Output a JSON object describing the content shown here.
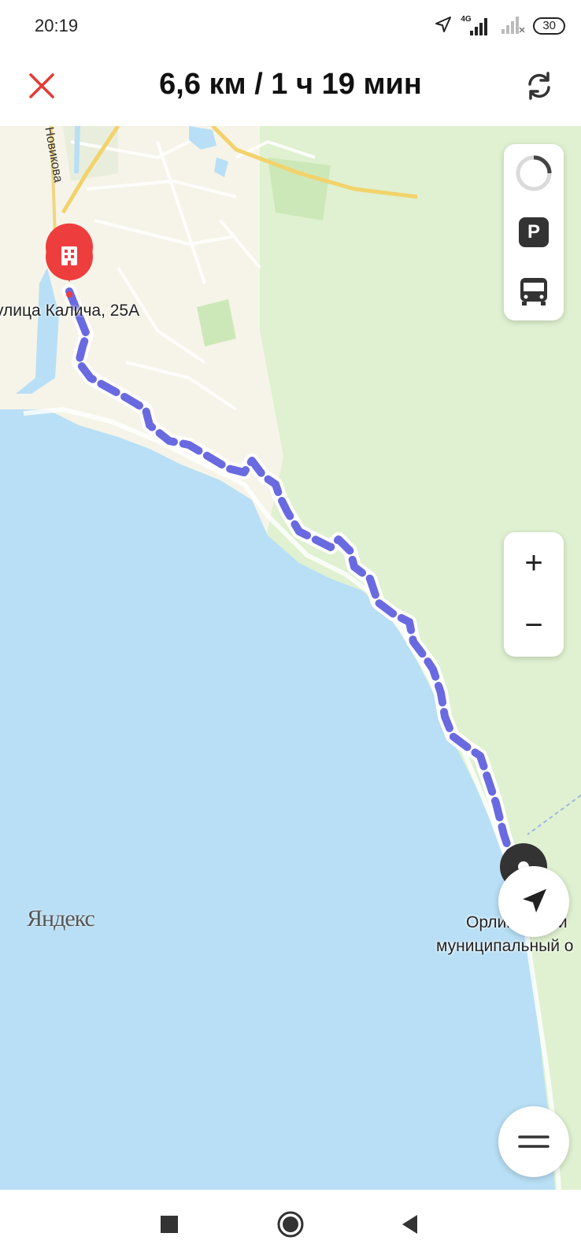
{
  "status_bar": {
    "time": "20:19",
    "network_label": "4G",
    "battery": "30",
    "icons": [
      "location-arrow-icon",
      "signal-4g-icon",
      "signal-no-sim-icon",
      "battery-icon"
    ]
  },
  "header": {
    "title": "6,6 км / 1 ч 19 мин",
    "close_icon": "close-icon",
    "refresh_icon": "refresh-icon",
    "accent_color": "#e53935"
  },
  "map": {
    "start_label": "улица Калича, 25А",
    "street_label": "Новикова",
    "end_label_line1": "Орлиновский",
    "end_label_line2": "муниципальный о",
    "watermark": "Яндекс",
    "route_color": "#6a6ae0",
    "water_color": "#b8dff5",
    "land_color": "#f6f4e8",
    "forest_color": "#dff1d0",
    "layer_buttons": [
      "traffic-icon",
      "parking-icon",
      "transit-bus-icon"
    ],
    "parking_letter": "P",
    "zoom_in": "+",
    "zoom_out": "−"
  },
  "nav_bar": {
    "buttons": [
      "recent-apps-icon",
      "home-icon",
      "back-icon"
    ]
  }
}
